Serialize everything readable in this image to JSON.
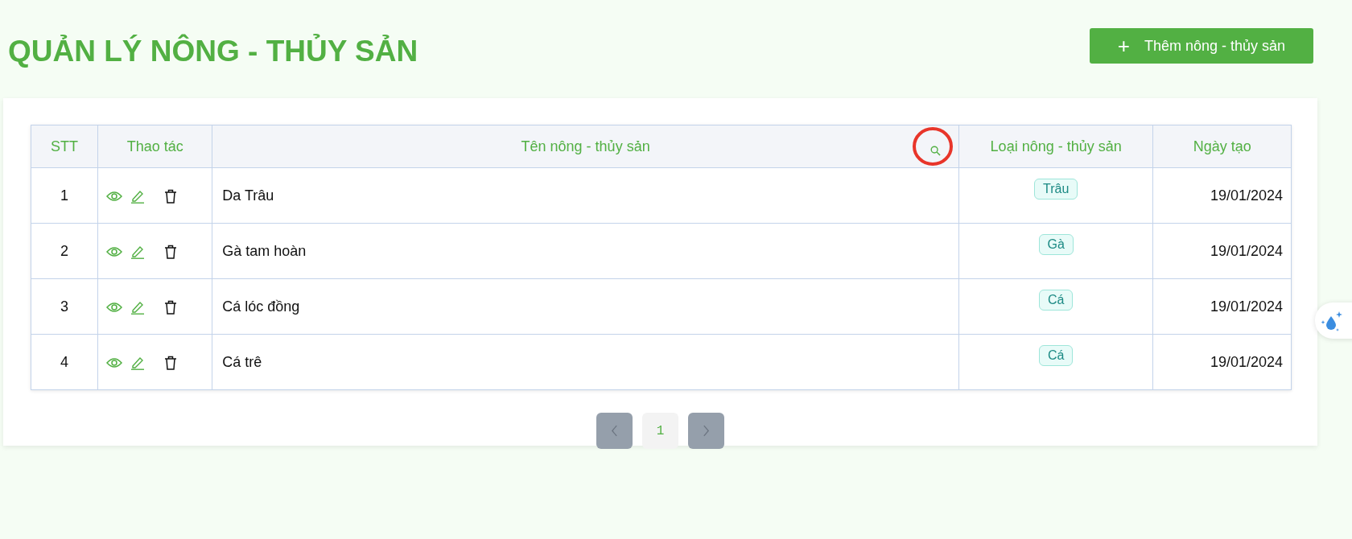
{
  "title": "QUẢN LÝ NÔNG - THỦY SẢN",
  "add_button": {
    "icon": "+",
    "label": "Thêm nông - thủy sản"
  },
  "table": {
    "columns": [
      "STT",
      "Thao tác",
      "Tên nông - thủy sản",
      "Loại nông - thủy sản",
      "Ngày tạo"
    ],
    "rows": [
      {
        "stt": "1",
        "name": "Da Trâu",
        "type": "Trâu",
        "created": "19/01/2024"
      },
      {
        "stt": "2",
        "name": "Gà tam hoàn",
        "type": "Gà",
        "created": "19/01/2024"
      },
      {
        "stt": "3",
        "name": "Cá lóc đồng",
        "type": "Cá",
        "created": "19/01/2024"
      },
      {
        "stt": "4",
        "name": "Cá trê",
        "type": "Cá",
        "created": "19/01/2024"
      }
    ]
  },
  "pagination": {
    "prev_disabled": true,
    "pages": [
      {
        "label": "1",
        "selected": true
      }
    ],
    "next_disabled": true
  }
}
